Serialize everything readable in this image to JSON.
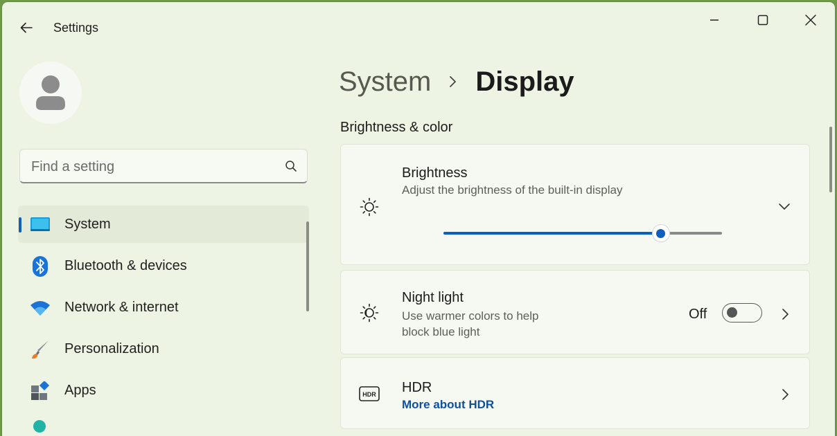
{
  "window": {
    "title": "Settings"
  },
  "colors": {
    "accent": "#0f5fbf",
    "window_bg": "#eef4e4",
    "card_bg": "#f6f9f1",
    "link": "#0e4f9f"
  },
  "search": {
    "placeholder": "Find a setting",
    "value": ""
  },
  "sidebar": {
    "items": [
      {
        "label": "System",
        "icon": "system-monitor-icon",
        "selected": true
      },
      {
        "label": "Bluetooth & devices",
        "icon": "bluetooth-icon",
        "selected": false
      },
      {
        "label": "Network & internet",
        "icon": "wifi-icon",
        "selected": false
      },
      {
        "label": "Personalization",
        "icon": "paintbrush-icon",
        "selected": false
      },
      {
        "label": "Apps",
        "icon": "apps-icon",
        "selected": false
      }
    ]
  },
  "breadcrumb": {
    "parent": "System",
    "current": "Display"
  },
  "section": {
    "title": "Brightness & color"
  },
  "brightness": {
    "title": "Brightness",
    "description": "Adjust the brightness of the built-in display",
    "level_percent": 78,
    "expanded": false
  },
  "night_light": {
    "title": "Night light",
    "description_line1": "Use warmer colors to help",
    "description_line2": "block blue light",
    "state_label": "Off",
    "on": false
  },
  "hdr": {
    "title": "HDR",
    "link": "More about HDR"
  }
}
